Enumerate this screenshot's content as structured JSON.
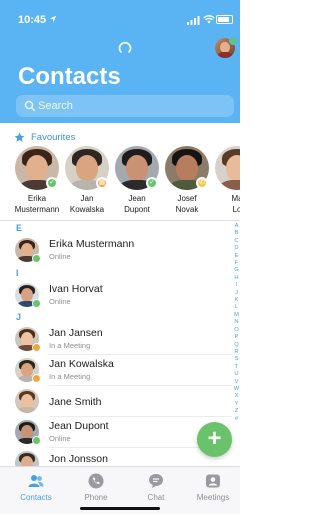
{
  "status_bar": {
    "time": "10:45"
  },
  "header": {
    "title": "Contacts",
    "search_placeholder": "Search",
    "accent": "#5ab3f2"
  },
  "favourites": {
    "title": "Favourites",
    "items": [
      {
        "first": "Erika",
        "last": "Mustermann",
        "status": "online"
      },
      {
        "first": "Jan",
        "last": "Kowalska",
        "status": "in-meeting"
      },
      {
        "first": "Jean",
        "last": "Dupont",
        "status": "online"
      },
      {
        "first": "Josef",
        "last": "Novak",
        "status": "on-call"
      },
      {
        "first": "Ma",
        "last": "Lo",
        "status": "none"
      }
    ]
  },
  "contacts": {
    "sections": [
      {
        "letter": "E",
        "rows": [
          {
            "name": "Erika Mustermann",
            "status": "Online",
            "state": "online"
          }
        ]
      },
      {
        "letter": "I",
        "rows": [
          {
            "name": "Ivan Horvat",
            "status": "Online",
            "state": "online"
          }
        ]
      },
      {
        "letter": "J",
        "rows": [
          {
            "name": "Jan Jansen",
            "status": "In a Meeting",
            "state": "in-meeting"
          },
          {
            "name": "Jan Kowalska",
            "status": "In a Meeting",
            "state": "in-meeting"
          },
          {
            "name": "Jane Smith",
            "status": "",
            "state": "none"
          },
          {
            "name": "Jean Dupont",
            "status": "Online",
            "state": "online"
          },
          {
            "name": "Jon Jonsson",
            "status": "",
            "state": "none"
          }
        ]
      }
    ]
  },
  "alphabet_index": [
    "A",
    "B",
    "C",
    "D",
    "E",
    "F",
    "G",
    "H",
    "I",
    "J",
    "K",
    "L",
    "M",
    "N",
    "O",
    "P",
    "Q",
    "R",
    "S",
    "T",
    "U",
    "V",
    "W",
    "X",
    "Y",
    "Z",
    "#"
  ],
  "add_button": {
    "label": "+"
  },
  "tabbar": {
    "tabs": [
      {
        "label": "Contacts",
        "icon": "contacts-icon",
        "active": true
      },
      {
        "label": "Phone",
        "icon": "phone-icon",
        "active": false
      },
      {
        "label": "Chat",
        "icon": "chat-icon",
        "active": false
      },
      {
        "label": "Meetings",
        "icon": "meetings-icon",
        "active": false
      }
    ]
  },
  "colors": {
    "online": "#64c56b",
    "in_meeting": "#f2a53a",
    "on_call": "#f5c84a",
    "link": "#4a9fe4"
  }
}
